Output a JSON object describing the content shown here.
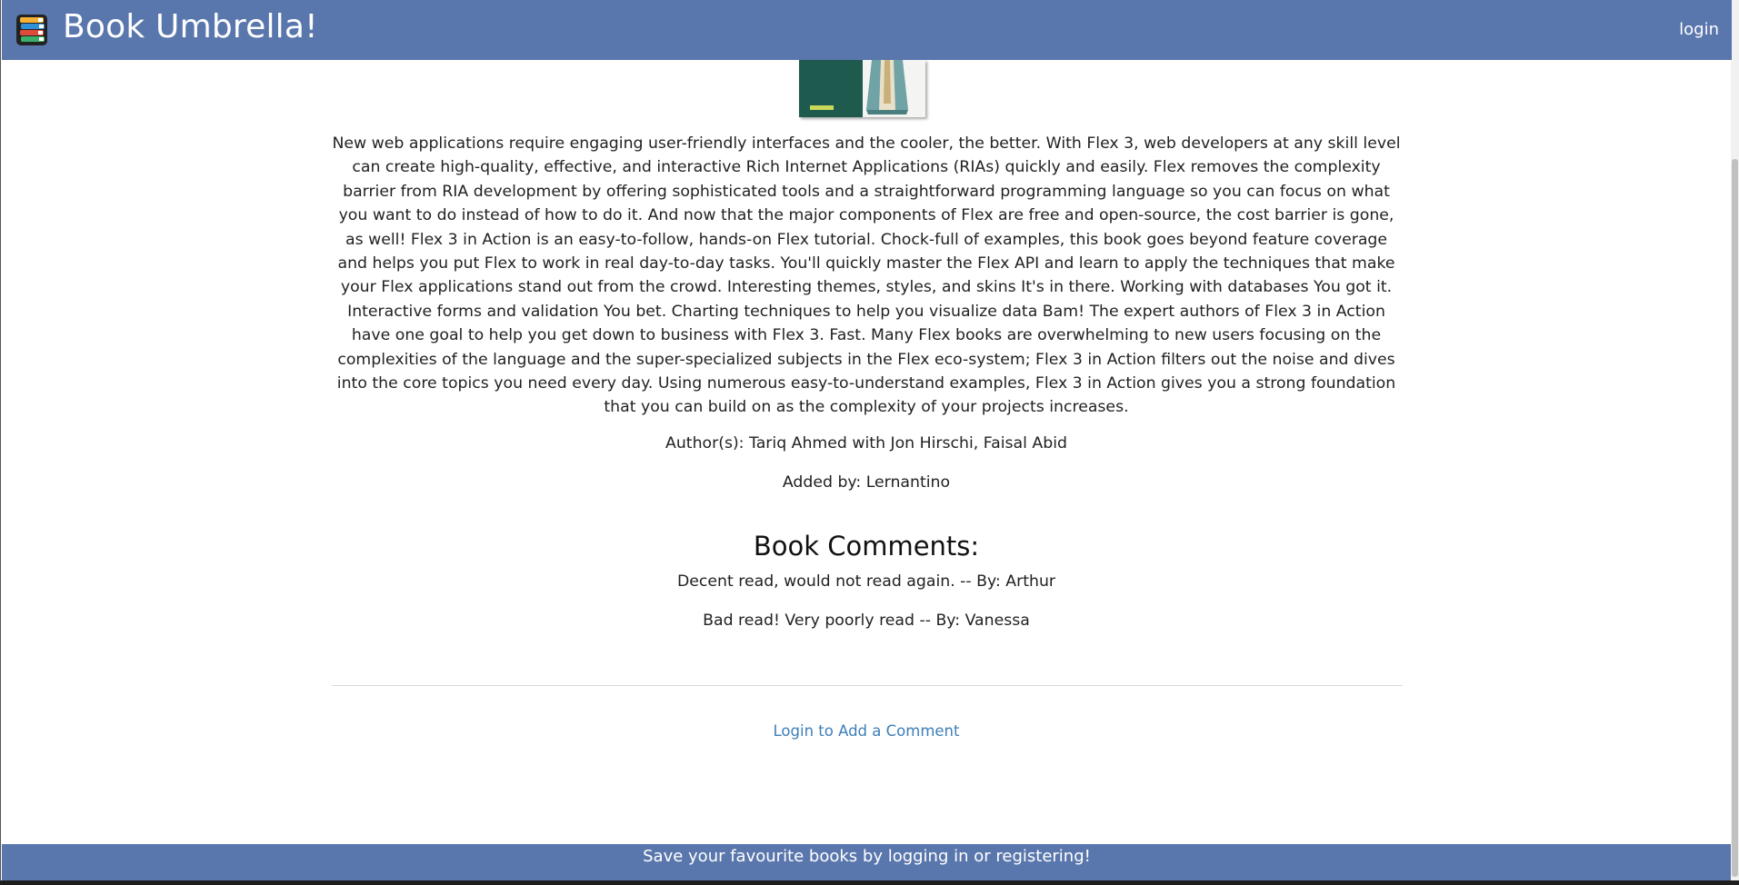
{
  "header": {
    "brand_title": "Book Umbrella!",
    "brand_icon": "stacked-books-icon",
    "login_label": "login",
    "background_color": "#5a77ad"
  },
  "book": {
    "cover_icon": "book-cover-image",
    "description": "New web applications require engaging user-friendly interfaces and the cooler, the better. With Flex 3, web developers at any skill level can create high-quality, effective, and interactive Rich Internet Applications (RIAs) quickly and easily. Flex removes the complexity barrier from RIA development by offering sophisticated tools and a straightforward programming language so you can focus on what you want to do instead of how to do it. And now that the major components of Flex are free and open-source, the cost barrier is gone, as well! Flex 3 in Action is an easy-to-follow, hands-on Flex tutorial. Chock-full of examples, this book goes beyond feature coverage and helps you put Flex to work in real day-to-day tasks. You'll quickly master the Flex API and learn to apply the techniques that make your Flex applications stand out from the crowd. Interesting themes, styles, and skins It's in there. Working with databases You got it. Interactive forms and validation You bet. Charting techniques to help you visualize data Bam! The expert authors of Flex 3 in Action have one goal to help you get down to business with Flex 3. Fast. Many Flex books are overwhelming to new users focusing on the complexities of the language and the super-specialized subjects in the Flex eco-system; Flex 3 in Action filters out the noise and dives into the core topics you need every day. Using numerous easy-to-understand examples, Flex 3 in Action gives you a strong foundation that you can build on as the complexity of your projects increases.",
    "authors": "Author(s): Tariq Ahmed with Jon Hirschi, Faisal Abid",
    "added_by": "Added by: Lernantino"
  },
  "comments": {
    "heading": "Book Comments:",
    "items": [
      "Decent read, would not read again. -- By: Arthur",
      "Bad read! Very poorly read -- By: Vanessa"
    ],
    "add_comment_link": "Login to Add a Comment",
    "link_color": "#3d7fb8"
  },
  "footer": {
    "text": "Save your favourite books by logging in or registering!"
  }
}
